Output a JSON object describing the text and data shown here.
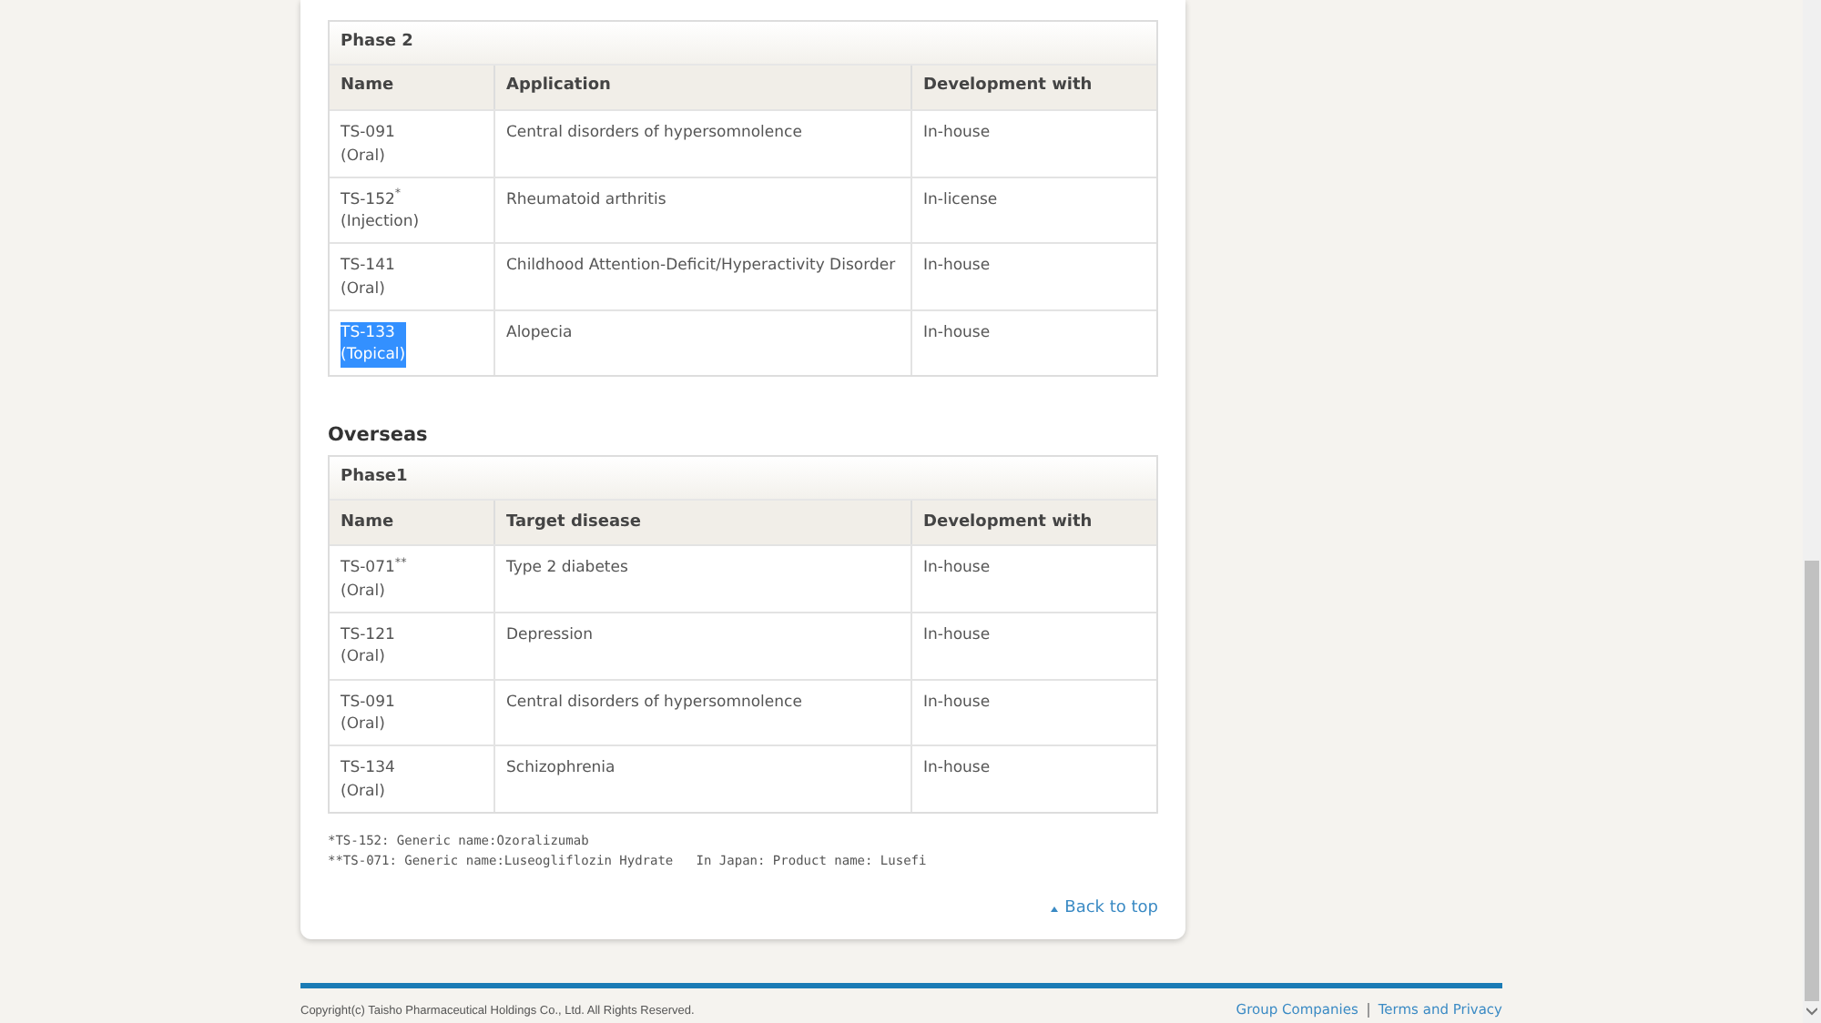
{
  "sections": [
    {
      "phase": "Phase 2",
      "columns": [
        "Name",
        "Application",
        "Development with"
      ],
      "rows": [
        {
          "name": "TS-091",
          "route": "(Oral)",
          "target": "Central disorders of hypersomnolence",
          "development": "In-house",
          "highlighted": false
        },
        {
          "name": "TS-152$^{*}$",
          "route": "(Injection)",
          "target": "Rheumatoid arthritis",
          "development": "In-license",
          "highlighted": false
        },
        {
          "name": "TS-141",
          "route": "(Oral)",
          "target": "Childhood Attention-Deficit/Hyperactivity Disorder",
          "development": "In-house",
          "highlighted": false
        },
        {
          "name": "TS-133",
          "route": "(Topical)",
          "target": "Alopecia",
          "development": "In-house",
          "highlighted": true
        }
      ]
    },
    {
      "heading": "Overseas",
      "phase": "Phase1",
      "columns": [
        "Name",
        "Target disease",
        "Development with"
      ],
      "rows": [
        {
          "name": "TS-071$^{**}$",
          "route": "(Oral)",
          "target": "Type 2 diabetes",
          "development": "In-house",
          "highlighted": false
        },
        {
          "name": "TS-121",
          "route": "(Oral)",
          "target": "Depression",
          "development": "In-house",
          "highlighted": false
        },
        {
          "name": "TS-091",
          "route": "(Oral)",
          "target": "Central disorders of hypersomnolence",
          "development": "In-house",
          "highlighted": false
        },
        {
          "name": "TS-134",
          "route": "(Oral)",
          "target": "Schizophrenia",
          "development": "In-house",
          "highlighted": false
        }
      ]
    }
  ],
  "footnotes": [
    "*TS-152: Generic name:Ozoralizumab",
    "**TS-071: Generic name:Luseogliflozin Hydrate   In Japan: Product name: Lusefi"
  ],
  "back_to_top": "Back to top",
  "footer": {
    "copyright": "Copyright(c) Taisho Pharmaceutical Holdings Co., Ltd. All Rights Reserved.",
    "links": [
      "Group Companies",
      "Terms and Privacy"
    ]
  }
}
